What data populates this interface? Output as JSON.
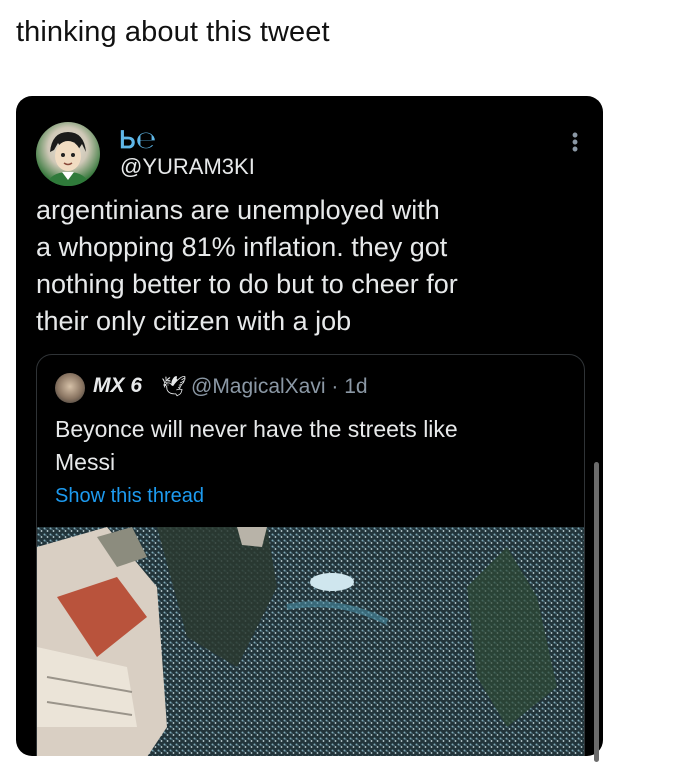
{
  "caption": "thinking about this tweet",
  "tweet": {
    "display_name": "Ꮟ℮",
    "handle": "@YURAM3KI",
    "text": "argentinians are unemployed with\na whopping 81% inflation. they got\nnothing better to do but to cheer for\ntheir only citizen with a job",
    "more_icon": "more-vertical-icon"
  },
  "quote": {
    "name": "MX 6",
    "badge": "🕊",
    "handle_time": "@MagicalXavi · 1d",
    "text": "Beyonce will never have the streets like\nMessi",
    "show_thread": "Show this thread"
  },
  "colors": {
    "card_bg": "#000000",
    "link": "#1d9bf0",
    "name_accent": "#5fb7e8",
    "text": "#e7e9ea",
    "muted": "#8b98a5"
  }
}
